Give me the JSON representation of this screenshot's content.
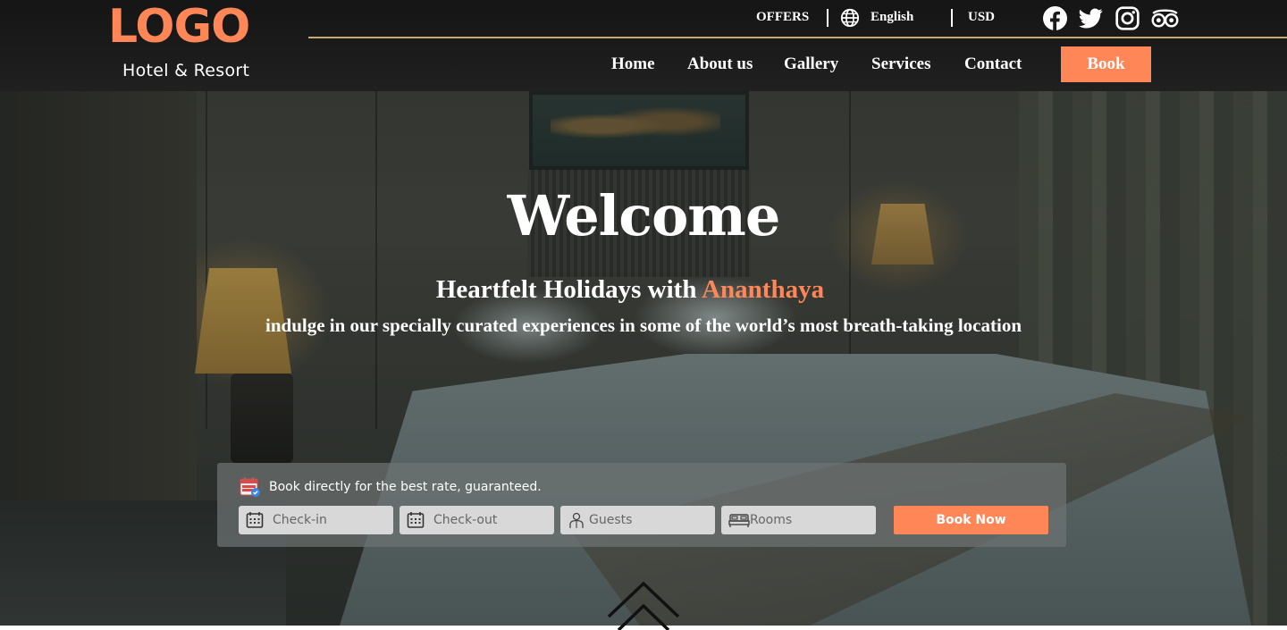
{
  "brand": {
    "logo": "LOGO",
    "subtitle": "Hotel & Resort"
  },
  "utility": {
    "offers": "OFFERS",
    "language": "English",
    "currency": "USD",
    "globe_icon": "globe-icon"
  },
  "social": [
    "facebook-icon",
    "twitter-icon",
    "instagram-icon",
    "tripadvisor-icon"
  ],
  "nav": {
    "items": [
      {
        "label": "Home"
      },
      {
        "label": "About us"
      },
      {
        "label": "Gallery"
      },
      {
        "label": "Services"
      },
      {
        "label": "Contact"
      }
    ],
    "book_label": "Book"
  },
  "hero": {
    "welcome": "Welcome",
    "tagline_prefix": "Heartfelt Holidays with ",
    "tagline_brand": "Ananthaya",
    "subline": "indulge in our specially curated experiences in some of the world’s most breath-taking location"
  },
  "booking": {
    "promo_text": "Book directly for the best rate, guaranteed.",
    "checkin_placeholder": "Check-in",
    "checkout_placeholder": "Check-out",
    "guests_placeholder": "Guests",
    "rooms_placeholder": "Rooms",
    "submit_label": "Book Now"
  },
  "colors": {
    "accent": "#ff8657",
    "header_bg": "#1a1a1a",
    "divider": "#c9a96e"
  }
}
